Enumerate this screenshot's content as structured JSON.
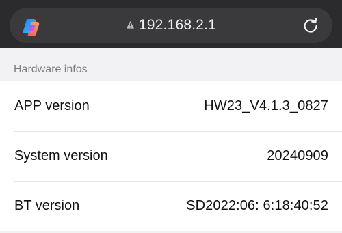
{
  "browser": {
    "url": "192.168.2.1",
    "logo_icon": "copilot-logo-icon",
    "warning_icon": "warning-triangle-icon",
    "reload_icon": "reload-icon",
    "colors": {
      "toolbar": "#2b2b2d",
      "pill": "#3a3a3d",
      "text": "#f1f1f1"
    }
  },
  "section": {
    "title": "Hardware infos"
  },
  "rows": [
    {
      "label": "APP version",
      "value": "HW23_V4.1.3_0827"
    },
    {
      "label": "System version",
      "value": "20240909"
    },
    {
      "label": "BT version",
      "value": "SD2022:06: 6:18:40:52"
    }
  ]
}
